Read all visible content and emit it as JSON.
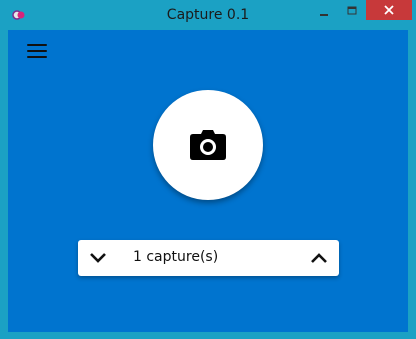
{
  "window": {
    "title": "Capture 0.1",
    "controls": {
      "minimize": "minimize",
      "maximize": "maximize",
      "close": "close"
    },
    "colors": {
      "frame": "#1ba1c4",
      "content": "#0074cf",
      "close_button": "#c7393a"
    }
  },
  "toolbar": {
    "menu_icon": "hamburger-menu-icon"
  },
  "capture": {
    "icon": "camera-icon"
  },
  "counter": {
    "label": "1 capture(s)",
    "decrease_icon": "chevron-down-icon",
    "increase_icon": "chevron-up-icon"
  }
}
